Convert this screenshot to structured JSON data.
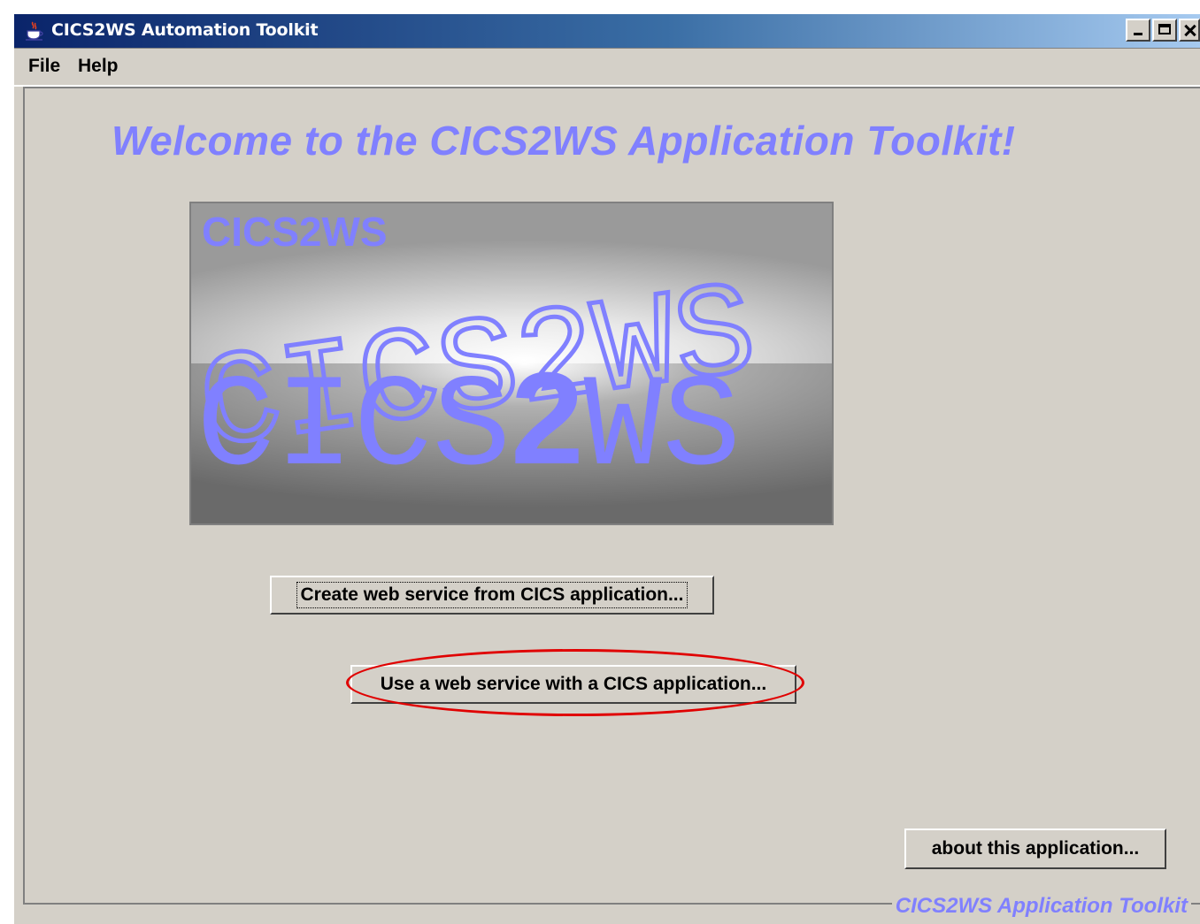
{
  "window": {
    "title": "CICS2WS Automation Toolkit",
    "icon": "java-coffee-cup-icon",
    "controls": [
      "minimize",
      "maximize",
      "close"
    ]
  },
  "menu": {
    "items": [
      {
        "label": "File"
      },
      {
        "label": "Help"
      }
    ]
  },
  "main": {
    "welcome_text": "Welcome to the CICS2WS Application Toolkit!",
    "logo": {
      "corner_text": "CICS2WS",
      "top_text": "CICS2WS",
      "bottom_text_pre": "CICS",
      "bottom_text_bold": "2",
      "bottom_text_post": "WS"
    },
    "buttons": {
      "create": "Create web service from CICS application...",
      "use": "Use a web service with a CICS application...",
      "about": "about this application..."
    },
    "footer_label": "CICS2WS Application Toolkit"
  },
  "colors": {
    "accent": "#8080ff",
    "window_bg": "#d4d0c8",
    "titlebar_start": "#0a246a",
    "titlebar_end": "#a6caf0",
    "annotation": "#e00000"
  }
}
